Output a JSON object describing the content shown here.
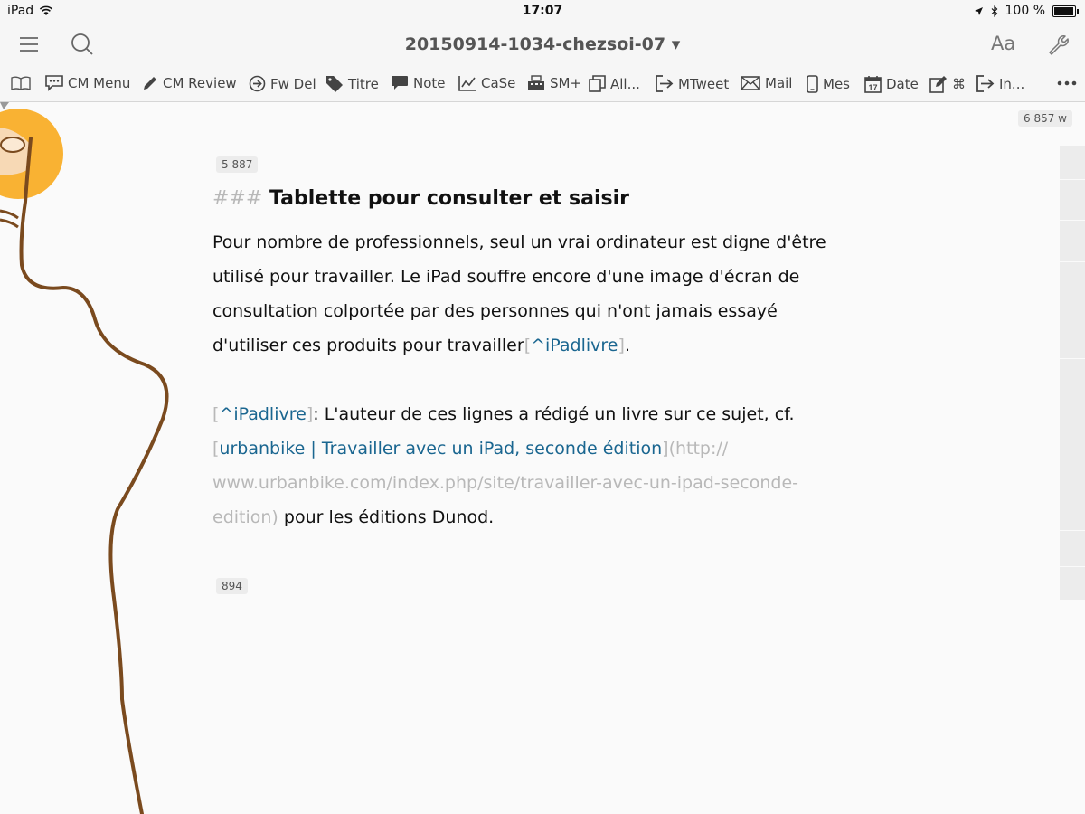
{
  "status": {
    "device": "iPad",
    "time": "17:07",
    "battery": "100 %"
  },
  "nav": {
    "title": "20150914-1034-chezsoi-07 ▾",
    "font_button": "Aa"
  },
  "toolbar": {
    "items": [
      {
        "label": "CM Menu",
        "icon": "speech-bubble-icon"
      },
      {
        "label": "CM Review",
        "icon": "pencil-icon"
      },
      {
        "label": "Fw Del",
        "icon": "arrow-circle-icon"
      },
      {
        "label": "Titre",
        "icon": "tag-icon"
      },
      {
        "label": "Note",
        "icon": "comment-icon"
      },
      {
        "label": "CaSe",
        "icon": "chart-line-icon"
      },
      {
        "label": "SM+",
        "icon": "cash-register-icon"
      },
      {
        "label": "All...",
        "icon": "copy-icon"
      },
      {
        "label": "MTweet",
        "icon": "export-icon"
      },
      {
        "label": "Mail",
        "icon": "envelope-icon"
      },
      {
        "label": "Mes",
        "icon": "phone-icon"
      },
      {
        "label": "Date",
        "icon": "calendar-icon"
      },
      {
        "label": "⌘",
        "icon": "edit-icon"
      },
      {
        "label": "In...",
        "icon": "export-icon"
      }
    ],
    "calendar_day": "17"
  },
  "editor": {
    "total_words": "6 857 w",
    "section_count_top": "5 887",
    "section_count_bottom": "894",
    "heading_marks": "###",
    "heading": "Tablette pour consulter et saisir",
    "paragraph1": {
      "line1": "Pour nombre de professionnels, seul un vrai ordinateur est digne d'être",
      "line2": "utilisé pour travailler. Le iPad souffre encore d'une image d'écran de",
      "line3": "consultation colportée par des personnes qui n'ont jamais essayé",
      "line4_text": "d'utiliser ces produits pour travailler",
      "line4_bracket_open": "[",
      "line4_ref": "^iPadlivre",
      "line4_bracket_close": "]",
      "line4_end": "."
    },
    "footnote": {
      "bracket_open": "[",
      "ref": "^iPadlivre",
      "bracket_close": "]",
      "text1": ": L'auteur de ces lignes a rédigé un livre sur ce sujet, cf.",
      "link_bracket_open": "[",
      "link_text": "urbanbike | Travailler avec un iPad, seconde édition",
      "link_bracket_close": "]",
      "url_line1": "(http://",
      "url_line2": "www.urbanbike.com/index.php/site/travailler-avec-un-ipad-seconde-",
      "url_line3": "edition)",
      "text2": " pour les éditions Dunod."
    }
  },
  "colors": {
    "link": "#1a6690",
    "markup_gray": "#b8b8b8",
    "touch_orange": "#f9b233",
    "line_brown": "#7a4a1e"
  }
}
